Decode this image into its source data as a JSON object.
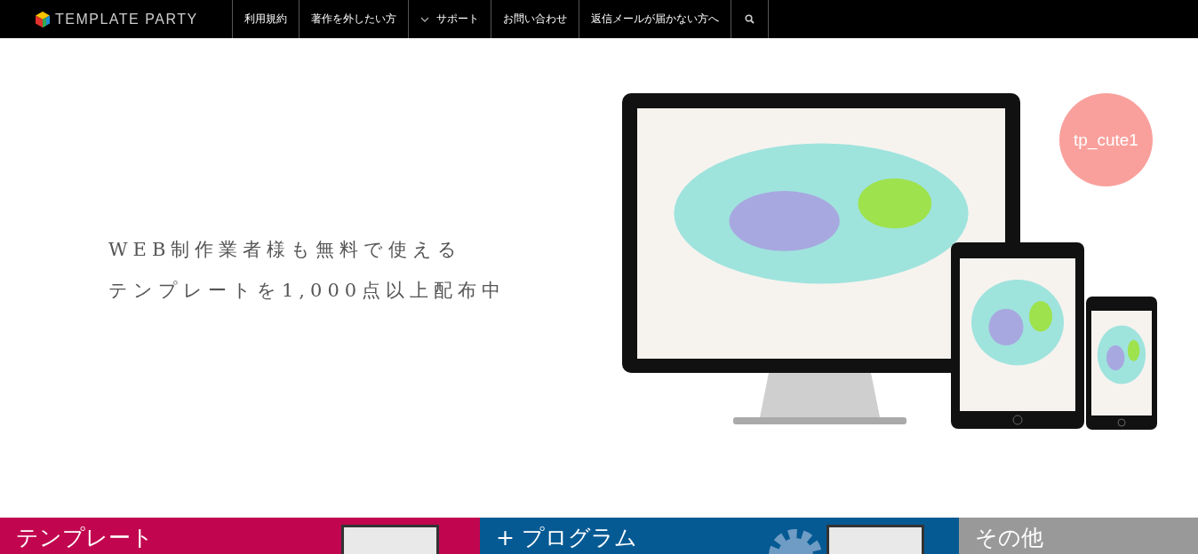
{
  "header": {
    "logo": "TEMPLATE PARTY",
    "nav": [
      {
        "label": "利用規約",
        "kind": "link"
      },
      {
        "label": "著作を外したい方",
        "kind": "link"
      },
      {
        "label": "サポート",
        "kind": "dropdown"
      },
      {
        "label": "お問い合わせ",
        "kind": "link"
      },
      {
        "label": "返信メールが届かない方へ",
        "kind": "link"
      },
      {
        "kind": "search"
      }
    ]
  },
  "hero": {
    "tagline": [
      "WEB制作業者様も無料で使える",
      "テンプレートを1,000点以上配布中"
    ],
    "badge": "tp_cute1"
  },
  "categories": [
    {
      "title": "テンプレート",
      "color": "#c1064f",
      "kind": "template"
    },
    {
      "title": "+ プログラム",
      "color": "#065a94",
      "kind": "program"
    },
    {
      "title": "その他",
      "color": "#999999",
      "kind": "other"
    }
  ]
}
